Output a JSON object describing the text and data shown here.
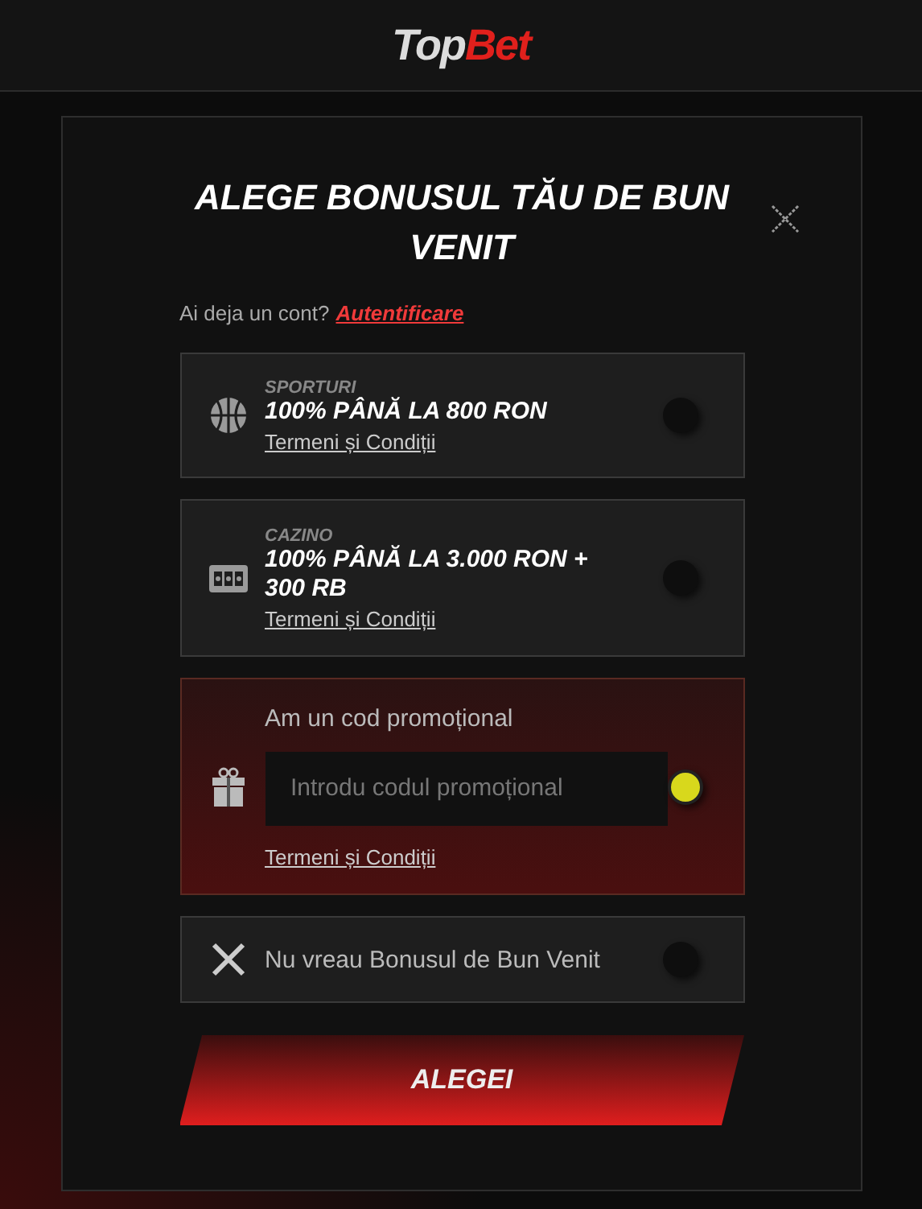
{
  "header": {
    "logo": {
      "first": "Top",
      "second": "Bet"
    }
  },
  "dialog": {
    "title": "ALEGE BONUSUL TĂU DE BUN VENIT",
    "login_prompt": "Ai deja un cont?",
    "login_link": "Autentificare",
    "options": [
      {
        "kind": "bonus",
        "category": "SPORTURI",
        "headline": "100% PÂNĂ LA 800 RON",
        "terms": "Termeni și Condiții",
        "selected": false
      },
      {
        "kind": "bonus",
        "category": "CAZINO",
        "headline": "100% PÂNĂ LA 3.000 RON + 300 RB",
        "terms": "Termeni și Condiții",
        "selected": false
      },
      {
        "kind": "promo",
        "label": "Am un cod promoțional",
        "placeholder": "Introdu codul promoțional",
        "terms": "Termeni și Condiții",
        "selected": true
      },
      {
        "kind": "none",
        "label": "Nu vreau Bonusul de Bun Venit",
        "selected": false
      }
    ],
    "submit": "ALEGEI"
  }
}
